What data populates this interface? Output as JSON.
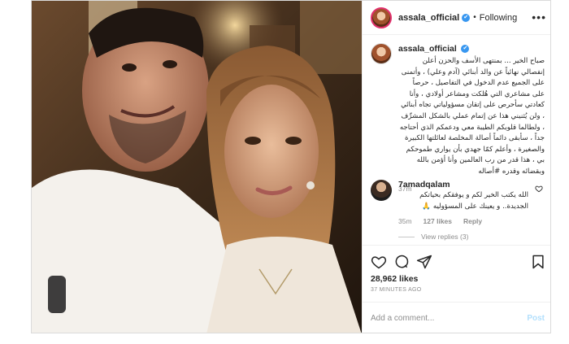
{
  "header": {
    "username": "assala_official",
    "verified_mark": "✔",
    "separator": "•",
    "follow_state": "Following",
    "more_glyph": "•••"
  },
  "caption": {
    "username": "assala_official",
    "text": "صباح الخير ... بمنتهى الأسف والحزن أعلن إنفصالي نهائياً عن والد أبنائي (آدم وعلي) ، وأتمنى على الجميع عدم الدخول في التفاصيل ، حرصاً على مشاعري التي هُلكت ومشاعر أولادي ، وأنا كعادتي سأحرص على إتقان مسؤولياتي تجاه أبنائي ، ولن يُثنيني هذا عن إتمام عملي بالشكل المشرِّف ، ولطالما قلوبكم الطيبة معي ودعمكم الذي أحتاجه جداً ، سأبقى دائماً أصالة المخلصة لعائلتها الكبيرة والصغيرة ، وأعلم كمّا جهدي بأن يواري طموحكم بي ، هذا قدر من رب العالمين وأنا أؤمن بالله وبقضائه وقدره #أصاله",
    "time": "37m"
  },
  "comment": {
    "username": "7amadqalam",
    "text": "الله يكتب الخير لكم و يوفقكم بحياتكم الجديدة.. و يعينك على المسؤوليه 🙏",
    "time": "35m",
    "likes": "127 likes",
    "reply": "Reply",
    "view_replies": "View replies (3)"
  },
  "post": {
    "likes": "28,962 likes",
    "ago": "37 MINUTES AGO"
  },
  "add_comment": {
    "placeholder": "Add a comment...",
    "post_label": "Post"
  },
  "colors": {
    "verified": "#3897f0",
    "post_disabled": "#b2dffc",
    "meta": "#8e8e8e"
  }
}
